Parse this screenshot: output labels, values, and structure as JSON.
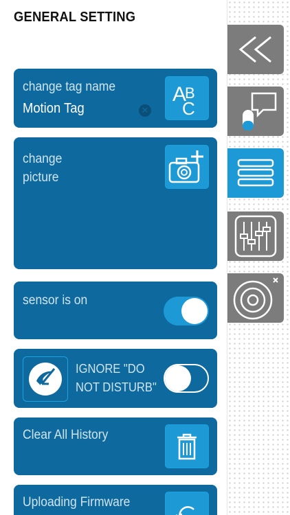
{
  "header": {
    "title": "GENERAL SETTING"
  },
  "tag_name": {
    "label": "change tag name",
    "value": "Motion Tag",
    "button_icon": "abc-text-icon"
  },
  "picture": {
    "label": "change\npicture",
    "button_icon": "camera-add-icon"
  },
  "sensor": {
    "label": "sensor is on",
    "toggle_state": "on"
  },
  "ignore_dnd": {
    "label": "IGNORE \"DO NOT DISTURB\"",
    "toggle_state": "off",
    "icon": "moon-arrow-icon"
  },
  "clear_history": {
    "label": "Clear All History",
    "button_icon": "trash-icon"
  },
  "firmware": {
    "label": "Uploading Firmware",
    "button_icon": "refresh-icon"
  },
  "sidebar": {
    "items": [
      {
        "name": "back",
        "icon": "double-chevron-left-icon",
        "color": "#7c7c7c"
      },
      {
        "name": "messages",
        "icon": "chat-sensor-icon",
        "color": "#7c7c7c"
      },
      {
        "name": "menu",
        "icon": "menu-icon",
        "color": "#1d9ad6",
        "active": true
      },
      {
        "name": "equalizer",
        "icon": "sliders-icon",
        "color": "#7c7c7c"
      },
      {
        "name": "target",
        "icon": "target-icon",
        "color": "#7c7c7c"
      }
    ]
  },
  "colors": {
    "card": "#0e6a9e",
    "accent": "#1d9ad6",
    "sidebar_grey": "#7c7c7c"
  }
}
